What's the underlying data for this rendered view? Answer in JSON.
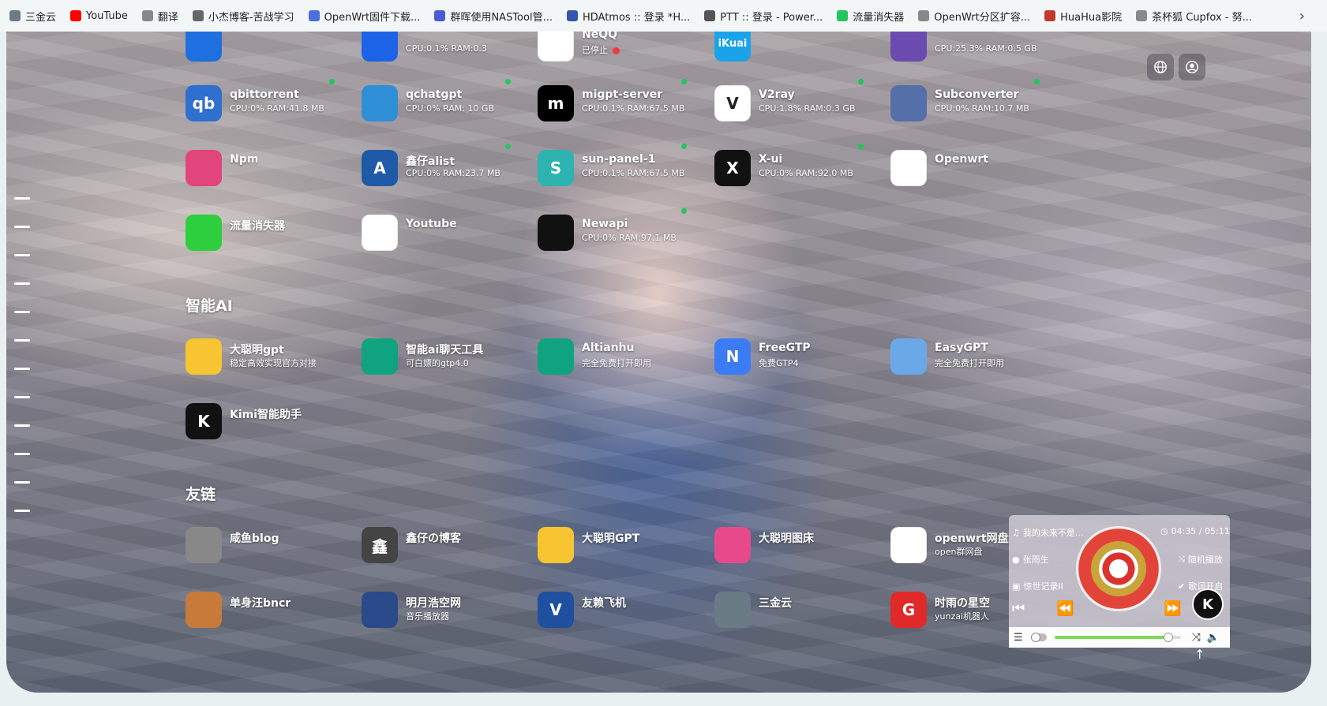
{
  "bookmarks": [
    {
      "label": "三金云",
      "icon": "circle-icon",
      "color": "#6b7b86"
    },
    {
      "label": "YouTube",
      "icon": "youtube-icon",
      "color": "#ff0000"
    },
    {
      "label": "翻译",
      "icon": "page-icon",
      "color": "#888888"
    },
    {
      "label": "小杰博客-苦战学习",
      "icon": "dot-icon",
      "color": "#666666"
    },
    {
      "label": "OpenWrt固件下载...",
      "icon": "openwrt-icon",
      "color": "#4b6fde"
    },
    {
      "label": "群晖使用NASTool管...",
      "icon": "m-icon",
      "color": "#4a5bd6"
    },
    {
      "label": "HDAtmos :: 登录 *H...",
      "icon": "hd-icon",
      "color": "#3355aa"
    },
    {
      "label": "PTT :: 登录 - Power...",
      "icon": "pt-icon",
      "color": "#555555"
    },
    {
      "label": "流量消失器",
      "icon": "gauge-icon",
      "color": "#22c55e"
    },
    {
      "label": "OpenWrt分区扩容...",
      "icon": "page-icon",
      "color": "#888888"
    },
    {
      "label": "HuaHua影院",
      "icon": "flower-icon",
      "color": "#c0392b"
    },
    {
      "label": "茶杯狐 Cupfox - 努...",
      "icon": "page-icon",
      "color": "#888888"
    }
  ],
  "overflow_label": "›",
  "apps": {
    "row0": [
      {
        "title": "",
        "sub": "",
        "icon": "shield-icon",
        "color": "#1e6fe0"
      },
      {
        "title": "",
        "sub": "CPU:0.1% RAM:0.3",
        "icon": "infinity-icon",
        "color": "#1c63e8"
      },
      {
        "title": "NeQQ",
        "sub": "已停止",
        "icon": "penguin-icon",
        "color": "#ffffff",
        "stopped": true
      },
      {
        "title": "",
        "sub": "",
        "icon": "ikuai-icon",
        "color": "#1aa3e8",
        "text": "iKuai"
      },
      {
        "title": "",
        "sub": "CPU:25.3% RAM:0.5 GB",
        "icon": "planet-icon",
        "color": "#6b4bb0"
      }
    ],
    "row1": [
      {
        "title": "qbittorrent",
        "sub": "CPU:0% RAM:41.8 MB",
        "icon": "qb-icon",
        "color": "#2f6fd0",
        "text": "qb"
      },
      {
        "title": "qchatgpt",
        "sub": "CPU:0% RAM: 10 GB",
        "icon": "chat-icon",
        "color": "#2f8fd6"
      },
      {
        "title": "migpt-server",
        "sub": "CPU:0.1% RAM:67.5 MB",
        "icon": "m-logo-icon",
        "color": "#000000",
        "text": "m"
      },
      {
        "title": "V2ray",
        "sub": "CPU:1.8% RAM:0.3 GB",
        "icon": "v-icon",
        "color": "#ffffff",
        "text": "V"
      },
      {
        "title": "Subconverter",
        "sub": "CPU:0% RAM:10.7 MB",
        "icon": "sub-icon",
        "color": "#5570a8"
      }
    ],
    "row2": [
      {
        "title": "Npm",
        "sub": "",
        "icon": "hex-icon",
        "color": "#e0457b"
      },
      {
        "title": "鑫仔alist",
        "sub": "CPU:0% RAM:23.7 MB",
        "icon": "alist-icon",
        "color": "#1f5aa8",
        "text": "A"
      },
      {
        "title": "sun-panel-1",
        "sub": "CPU:0.1% RAM:67.5 MB",
        "icon": "s-icon",
        "color": "#2fb3b0",
        "text": "S"
      },
      {
        "title": "X-ui",
        "sub": "CPU:0% RAM:92.0 MB",
        "icon": "x-icon",
        "color": "#111111",
        "text": "X"
      },
      {
        "title": "Openwrt",
        "sub": "",
        "icon": "wifi-icon",
        "color": "#ffffff"
      }
    ],
    "row3": [
      {
        "title": "流量消失器",
        "sub": "",
        "icon": "gauge-icon",
        "color": "#2dcf3f"
      },
      {
        "title": "Youtube",
        "sub": "",
        "icon": "youtube-icon",
        "color": "#ffffff"
      },
      {
        "title": "Newapi",
        "sub": "CPU:0% RAM:97.1 MB",
        "icon": "openai-icon",
        "color": "#111111"
      }
    ]
  },
  "sections": {
    "ai": "智能AI",
    "links": "友链"
  },
  "ai_apps": [
    {
      "title": "大聪明gpt",
      "sub": "稳定高效实现官方对接",
      "icon": "pikachu-icon",
      "color": "#f6c531"
    },
    {
      "title": "智能ai聊天工具",
      "sub": "可白嫖的gtp4.0",
      "icon": "openai-icon",
      "color": "#10a37f"
    },
    {
      "title": "Altianhu",
      "sub": "完全免费打开即用",
      "icon": "openai-icon",
      "color": "#10a37f"
    },
    {
      "title": "FreeGTP",
      "sub": "免费GTP4",
      "icon": "n-icon",
      "color": "#3b7bf6",
      "text": "N"
    },
    {
      "title": "EasyGPT",
      "sub": "完全免费打开即用",
      "icon": "robot-icon",
      "color": "#6aa8e8"
    }
  ],
  "ai_apps2": [
    {
      "title": "Kimi智能助手",
      "sub": "",
      "icon": "k-icon",
      "color": "#111111",
      "text": "K"
    }
  ],
  "links": [
    {
      "title": "咸鱼blog",
      "sub": "",
      "icon": "fish-icon",
      "color": "#888888"
    },
    {
      "title": "鑫仔の博客",
      "sub": "",
      "icon": "xin-icon",
      "color": "#444444",
      "text": "鑫"
    },
    {
      "title": "大聪明GPT",
      "sub": "",
      "icon": "pikachu-icon",
      "color": "#f6c531"
    },
    {
      "title": "大聪明图床",
      "sub": "",
      "icon": "pinwheel-icon",
      "color": "#e64a8b"
    },
    {
      "title": "openwrt网盘",
      "sub": "open群网盘",
      "icon": "wifi-icon",
      "color": "#ffffff"
    }
  ],
  "links2": [
    {
      "title": "单身汪bncr",
      "sub": "",
      "icon": "avatar-icon",
      "color": "#c87a3a"
    },
    {
      "title": "明月浩空网",
      "sub": "音乐播放器",
      "icon": "wolf-icon",
      "color": "#2a4a8a"
    },
    {
      "title": "友赖飞机",
      "sub": "",
      "icon": "v-icon",
      "color": "#1f4f9f",
      "text": "V"
    },
    {
      "title": "三金云",
      "sub": "",
      "icon": "rocket-icon",
      "color": "#6b7b86"
    },
    {
      "title": "时雨の星空",
      "sub": "yunzai机器人",
      "icon": "g-icon",
      "color": "#e02a2a",
      "text": "G"
    }
  ],
  "player": {
    "song": "我的未来不是...",
    "time": "04:35 / 05:11",
    "artist": "张雨生",
    "mode": "随机播放",
    "album": "惊世记录II",
    "lyrics": "歌词开启",
    "progress": 0.9,
    "accent": "#7ed957"
  },
  "kimi_float": "K"
}
